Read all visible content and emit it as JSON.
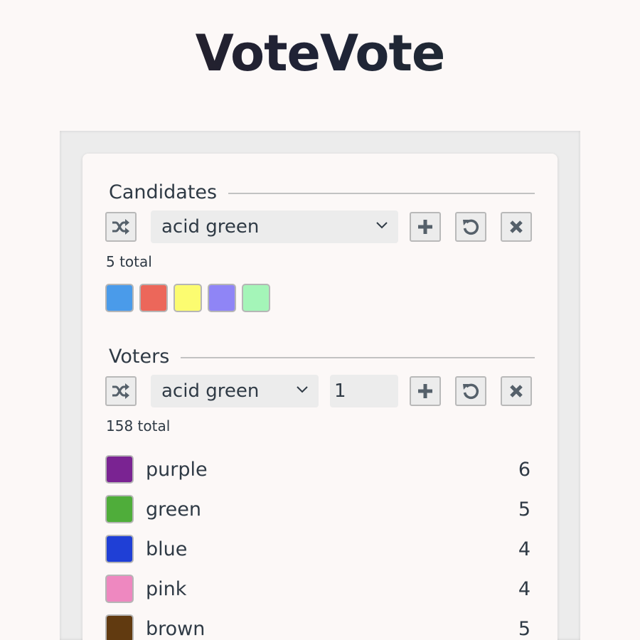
{
  "app": {
    "title": "VoteVote"
  },
  "colors": {
    "accent_text": "#2f3a45",
    "panel_bg": "#ececec",
    "page_bg": "#fcf8f7"
  },
  "candidates": {
    "heading": "Candidates",
    "shuffle_icon": "shuffle-icon",
    "selected_color": "acid green",
    "add_icon": "plus-icon",
    "reset_icon": "undo-icon",
    "clear_icon": "close-icon",
    "total_label": "5 total",
    "swatches": [
      {
        "color": "#4a9bea"
      },
      {
        "color": "#ec675a"
      },
      {
        "color": "#fcfc70"
      },
      {
        "color": "#8f85f6"
      },
      {
        "color": "#a4f5b8"
      }
    ]
  },
  "voters": {
    "heading": "Voters",
    "shuffle_icon": "shuffle-icon",
    "selected_color": "acid green",
    "quantity": "1",
    "add_icon": "plus-icon",
    "reset_icon": "undo-icon",
    "clear_icon": "close-icon",
    "total_label": "158 total",
    "items": [
      {
        "name": "purple",
        "count": "6",
        "color": "#7a2392"
      },
      {
        "name": "green",
        "count": "5",
        "color": "#4fad3a"
      },
      {
        "name": "blue",
        "count": "4",
        "color": "#1f3fd6"
      },
      {
        "name": "pink",
        "count": "4",
        "color": "#ee88c0"
      },
      {
        "name": "brown",
        "count": "5",
        "color": "#613a10"
      }
    ]
  }
}
